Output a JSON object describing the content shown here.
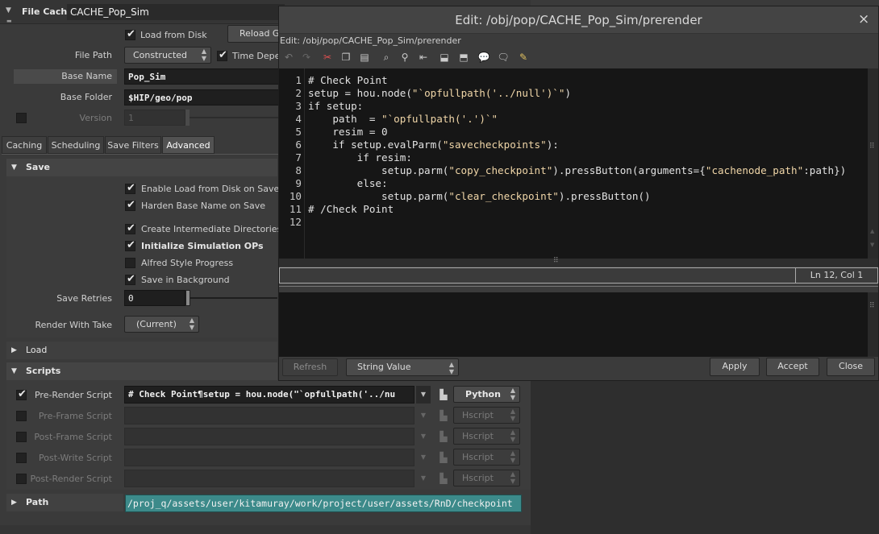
{
  "node": {
    "type_label": "File Cache",
    "name": "CACHE_Pop_Sim"
  },
  "params": {
    "load_from_disk": "Load from Disk",
    "reload_label": "Reload Ge",
    "file_path_label": "File Path",
    "file_path_value": "Constructed",
    "time_dep_label": "Time Depe",
    "base_name_label": "Base Name",
    "base_name_value": "Pop_Sim",
    "base_folder_label": "Base Folder",
    "base_folder_value": "$HIP/geo/pop",
    "version_label": "Version",
    "version_value": "1"
  },
  "tabs": [
    "Caching",
    "Scheduling",
    "Save Filters",
    "Advanced"
  ],
  "save": {
    "title": "Save",
    "options": [
      {
        "label": "Enable Load from Disk on Save",
        "checked": true,
        "bold": false
      },
      {
        "label": "Harden Base Name on Save",
        "checked": true,
        "bold": false
      },
      {
        "label": "Create Intermediate Directories",
        "checked": true,
        "bold": false
      },
      {
        "label": "Initialize Simulation OPs",
        "checked": true,
        "bold": true
      },
      {
        "label": "Alfred Style Progress",
        "checked": false,
        "bold": false
      },
      {
        "label": "Save in Background",
        "checked": true,
        "bold": false
      }
    ],
    "retries_label": "Save Retries",
    "retries_value": "0",
    "render_take_label": "Render With Take",
    "render_take_value": "(Current)"
  },
  "load": {
    "title": "Load"
  },
  "scripts": {
    "title": "Scripts",
    "rows": [
      {
        "label": "Pre-Render Script",
        "value": "# Check Point¶setup = hou.node(\"`opfullpath('../nu",
        "lang": "Python",
        "enabled": true
      },
      {
        "label": "Pre-Frame Script",
        "value": "",
        "lang": "Hscript",
        "enabled": false
      },
      {
        "label": "Post-Frame Script",
        "value": "",
        "lang": "Hscript",
        "enabled": false
      },
      {
        "label": "Post-Write Script",
        "value": "",
        "lang": "Hscript",
        "enabled": false
      },
      {
        "label": "Post-Render Script",
        "value": "",
        "lang": "Hscript",
        "enabled": false
      }
    ]
  },
  "path": {
    "title": "Path",
    "value": "/proj_q/assets/user/kitamuray/work/project/user/assets/RnD/checkpoint"
  },
  "editor": {
    "title": "Edit: /obj/pop/CACHE_Pop_Sim/prerender",
    "subtitle": "Edit: /obj/pop/CACHE_Pop_Sim/prerender",
    "close_glyph": "×",
    "code_lines": [
      "# Check Point",
      "setup = hou.node(\"`opfullpath('../null')`\")",
      "if setup:",
      "    path  = \"`opfullpath('.')`\"",
      "    resim = 0",
      "    if setup.evalParm(\"savecheckpoints\"):",
      "        if resim:",
      "            setup.parm(\"copy_checkpoint\").pressButton(arguments={\"cachenode_path\":path})",
      "        else:",
      "            setup.parm(\"clear_checkpoint\").pressButton()",
      "# /Check Point",
      ""
    ],
    "status": "Ln 12, Col 1",
    "refresh_label": "Refresh",
    "value_type": "String Value",
    "apply_label": "Apply",
    "accept_label": "Accept",
    "close_label": "Close"
  }
}
